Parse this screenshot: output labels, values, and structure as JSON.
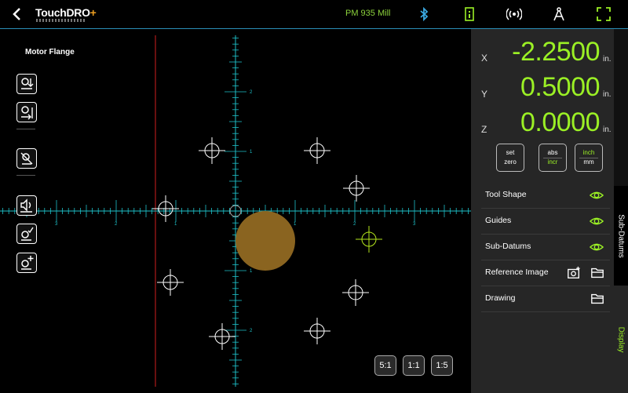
{
  "header": {
    "logo_text": "TouchDRO",
    "logo_plus": "+",
    "machine_name": "PM 935 Mill",
    "icons": [
      "back-icon",
      "bluetooth-icon",
      "dro-icon",
      "broadcast-icon",
      "compass-icon",
      "fullscreen-icon"
    ]
  },
  "canvas": {
    "drawing_title": "Motor Flange",
    "tools": [
      "tool-offset-icon",
      "tool-path-icon",
      "edge-find-icon",
      "sound-icon",
      "edit-shape-icon",
      "add-shape-icon"
    ],
    "zoom": [
      "5:1",
      "1:1",
      "1:5"
    ],
    "tick_labels": {
      "x": [
        "3",
        "2",
        "1",
        "1",
        "2",
        "3"
      ],
      "y": [
        "2",
        "1",
        "1",
        "2"
      ]
    },
    "colors": {
      "grid_axis": "#1ec0c8",
      "guide": "#d02020",
      "tool": "#8a6420",
      "target": "#b5e61d",
      "datum": "#ffffff"
    }
  },
  "readout": {
    "axes": [
      {
        "letter": "X",
        "value": "-2.2500",
        "unit": "in."
      },
      {
        "letter": "Y",
        "value": "0.5000",
        "unit": "in."
      },
      {
        "letter": "Z",
        "value": "0.0000",
        "unit": "in."
      }
    ],
    "modes": [
      {
        "top": "set",
        "bottom": "zero",
        "active": ""
      },
      {
        "top": "abs",
        "bottom": "incr",
        "active": "bottom"
      },
      {
        "top": "inch",
        "bottom": "mm",
        "active": "top"
      }
    ]
  },
  "display_options": [
    {
      "label": "Tool Shape",
      "icons": [
        "eye-icon"
      ]
    },
    {
      "label": "Guides",
      "icons": [
        "eye-icon"
      ]
    },
    {
      "label": "Sub-Datums",
      "icons": [
        "eye-icon"
      ]
    },
    {
      "label": "Reference Image",
      "icons": [
        "camera-icon",
        "folder-icon"
      ]
    },
    {
      "label": "Drawing",
      "icons": [
        "folder-icon"
      ]
    }
  ],
  "side_tabs": [
    "Sub-Datums",
    "Display"
  ],
  "accent_color": "#9bf025"
}
